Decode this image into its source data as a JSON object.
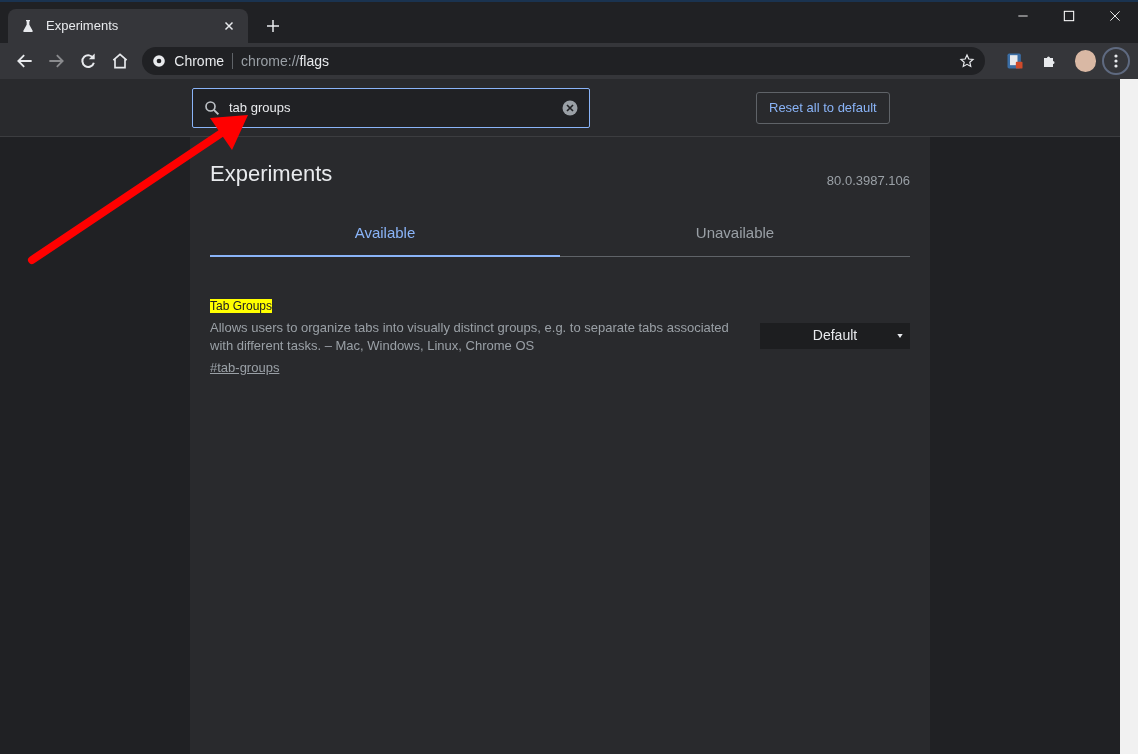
{
  "browser": {
    "tab": {
      "title": "Experiments",
      "selected": true
    },
    "address": {
      "site_label": "Chrome",
      "url_prefix": "chrome://",
      "url_path": "flags"
    }
  },
  "header": {
    "search": {
      "value": "tab groups"
    },
    "reset_button": "Reset all to default"
  },
  "page": {
    "title": "Experiments",
    "version": "80.0.3987.106",
    "tabs": [
      {
        "label": "Available",
        "selected": true
      },
      {
        "label": "Unavailable",
        "selected": false
      }
    ],
    "flags": [
      {
        "title": "Tab Groups",
        "highlighted": true,
        "description": "Allows users to organize tabs into visually distinct groups, e.g. to separate tabs associated with different tasks. – Mac, Windows, Linux, Chrome OS",
        "link": "#tab-groups",
        "setting": "Default"
      }
    ]
  }
}
